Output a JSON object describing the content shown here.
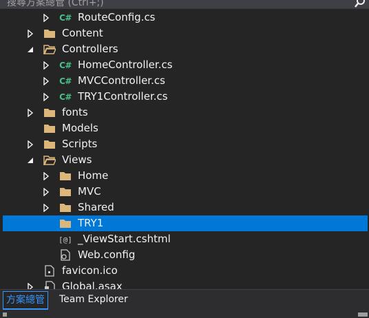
{
  "search": {
    "placeholder": "搜尋方案總管 (Ctrl+;)"
  },
  "tree": [
    {
      "label": "RouteConfig.cs",
      "icon": "csharp-file",
      "arrow": "collapsed",
      "depth": 2
    },
    {
      "label": "Content",
      "icon": "folder",
      "arrow": "collapsed",
      "depth": 1
    },
    {
      "label": "Controllers",
      "icon": "folder-open",
      "arrow": "expanded",
      "depth": 1
    },
    {
      "label": "HomeController.cs",
      "icon": "csharp-file",
      "arrow": "collapsed",
      "depth": 2
    },
    {
      "label": "MVCController.cs",
      "icon": "csharp-file",
      "arrow": "collapsed",
      "depth": 2
    },
    {
      "label": "TRY1Controller.cs",
      "icon": "csharp-file",
      "arrow": "collapsed",
      "depth": 2
    },
    {
      "label": "fonts",
      "icon": "folder",
      "arrow": "collapsed",
      "depth": 1
    },
    {
      "label": "Models",
      "icon": "folder",
      "arrow": "none",
      "depth": 1
    },
    {
      "label": "Scripts",
      "icon": "folder",
      "arrow": "collapsed",
      "depth": 1
    },
    {
      "label": "Views",
      "icon": "folder-open",
      "arrow": "expanded",
      "depth": 1
    },
    {
      "label": "Home",
      "icon": "folder",
      "arrow": "collapsed",
      "depth": 2
    },
    {
      "label": "MVC",
      "icon": "folder",
      "arrow": "collapsed",
      "depth": 2
    },
    {
      "label": "Shared",
      "icon": "folder",
      "arrow": "collapsed",
      "depth": 2
    },
    {
      "label": "TRY1",
      "icon": "folder",
      "arrow": "none",
      "depth": 2,
      "selected": true
    },
    {
      "label": "_ViewStart.cshtml",
      "icon": "razor-file",
      "arrow": "none",
      "depth": 2
    },
    {
      "label": "Web.config",
      "icon": "config-file",
      "arrow": "none",
      "depth": 2
    },
    {
      "label": "favicon.ico",
      "icon": "ico-file",
      "arrow": "none",
      "depth": 1
    },
    {
      "label": "Global.asax",
      "icon": "asax-file",
      "arrow": "collapsed",
      "depth": 1
    }
  ],
  "tabs": {
    "solution_explorer": "方案總管",
    "team_explorer": "Team Explorer"
  },
  "colors": {
    "background": "#252526",
    "selected": "#0078d7",
    "folder": "#dcb67a",
    "csharp": "#47c28a",
    "active_tab": "#3794ff"
  }
}
